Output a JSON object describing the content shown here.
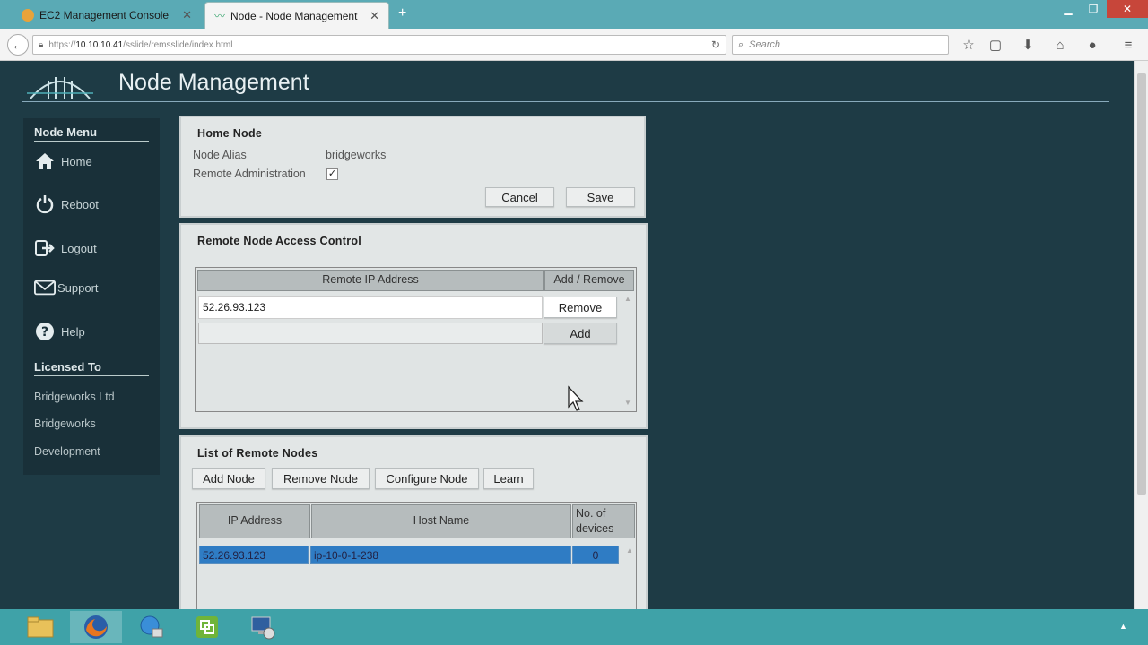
{
  "browser": {
    "tabs": [
      {
        "label": "EC2 Management Console",
        "icon": "aws-icon"
      },
      {
        "label": "Node - Node Management",
        "icon": "pulse-icon"
      }
    ],
    "url": {
      "prefix": "https://",
      "host": "10.10.10.41",
      "path": "/sslide/remsslide/index.html"
    },
    "search_placeholder": "Search"
  },
  "page": {
    "title": "Node Management"
  },
  "sidebar": {
    "menu_heading": "Node Menu",
    "items": [
      {
        "label": "Home",
        "icon": "home-icon"
      },
      {
        "label": "Reboot",
        "icon": "power-icon"
      },
      {
        "label": "Logout",
        "icon": "logout-icon"
      },
      {
        "label": "Support",
        "icon": "mail-icon"
      },
      {
        "label": "Help",
        "icon": "help-icon"
      }
    ],
    "licensed_heading": "Licensed To",
    "licensed_lines": [
      "Bridgeworks Ltd",
      "Bridgeworks",
      "Development"
    ]
  },
  "home_node": {
    "title": "Home Node",
    "alias_label": "Node Alias",
    "alias_value": "bridgeworks",
    "remote_admin_label": "Remote Administration",
    "remote_admin_checked": true,
    "check_mark": "✓",
    "cancel_label": "Cancel",
    "save_label": "Save"
  },
  "access_control": {
    "title": "Remote Node Access Control",
    "col_ip": "Remote IP Address",
    "col_action": "Add / Remove",
    "rows": [
      {
        "ip": "52.26.93.123",
        "action": "Remove"
      }
    ],
    "new_row_action": "Add"
  },
  "remote_nodes": {
    "title": "List of Remote Nodes",
    "buttons": [
      "Add Node",
      "Remove Node",
      "Configure Node",
      "Learn"
    ],
    "col_ip": "IP Address",
    "col_host": "Host Name",
    "col_devices_line1": "No. of",
    "col_devices_line2": "devices",
    "rows": [
      {
        "ip": "52.26.93.123",
        "host": "ip-10-0-1-238",
        "devices": "0"
      }
    ]
  },
  "colors": {
    "page_bg": "#1e3b45",
    "tabbar": "#5aaab5",
    "taskbar": "#3fa2a8",
    "selection": "#2f7cc4"
  }
}
